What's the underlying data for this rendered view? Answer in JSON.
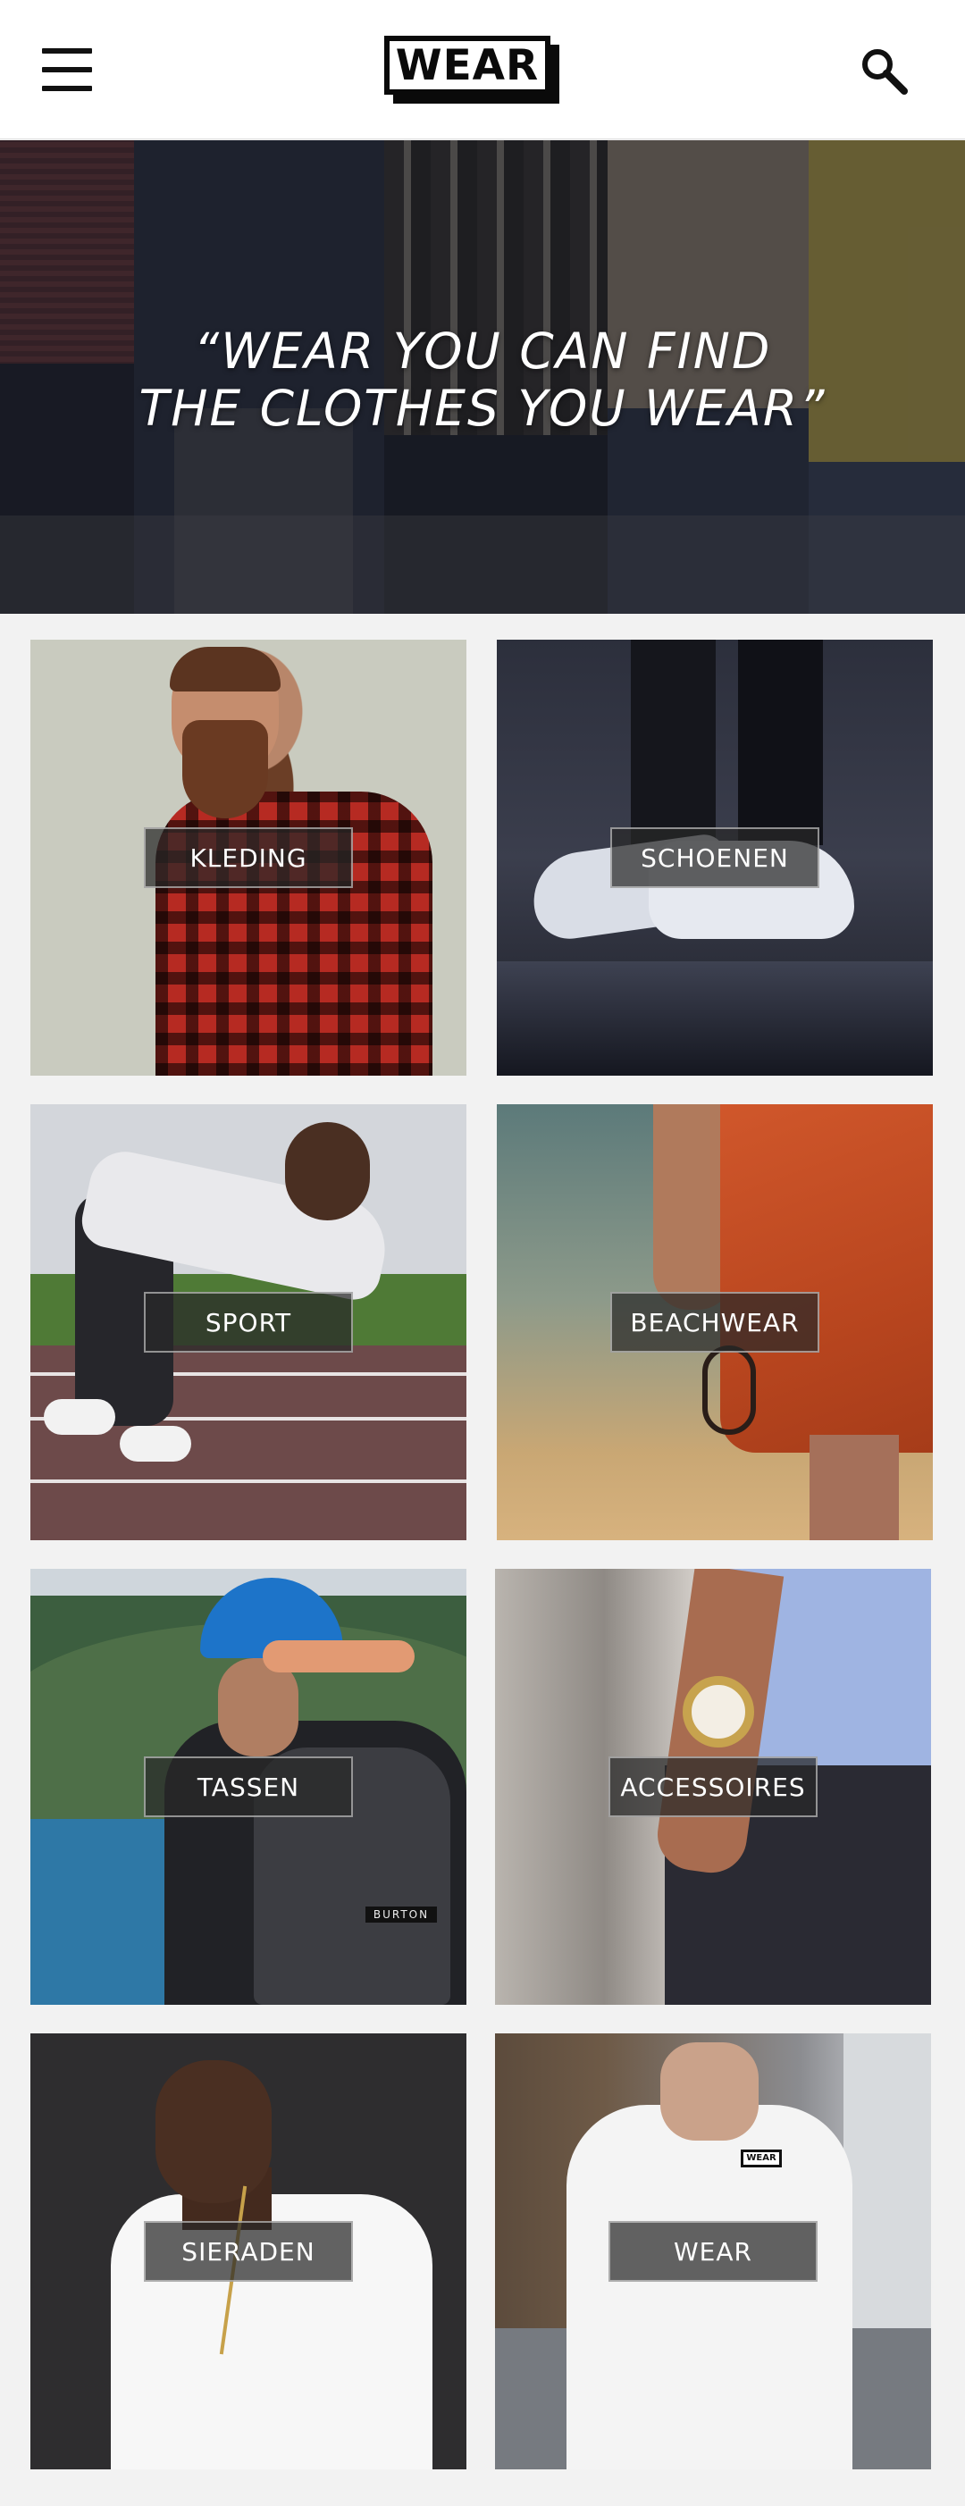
{
  "header": {
    "logo_text": "WEAR",
    "menu_icon": "hamburger-menu-icon",
    "search_icon": "search-icon"
  },
  "hero": {
    "quote_line1": "“WEAR YOU CAN FIND",
    "quote_line2": "THE CLOTHES YOU WEAR”"
  },
  "categories": [
    {
      "label": "KLEDING"
    },
    {
      "label": "SCHOENEN"
    },
    {
      "label": "SPORT"
    },
    {
      "label": "BEACHWEAR"
    },
    {
      "label": "TASSEN"
    },
    {
      "label": "ACCESSOIRES"
    },
    {
      "label": "SIERADEN"
    },
    {
      "label": "WEAR"
    }
  ],
  "images": {
    "backpack_brand": "BURTON",
    "shirt_logo": "WEAR"
  },
  "colors": {
    "header_bg": "#ffffff",
    "page_bg": "#f2f2f2",
    "label_bg": "rgba(40,40,40,0.72)"
  }
}
